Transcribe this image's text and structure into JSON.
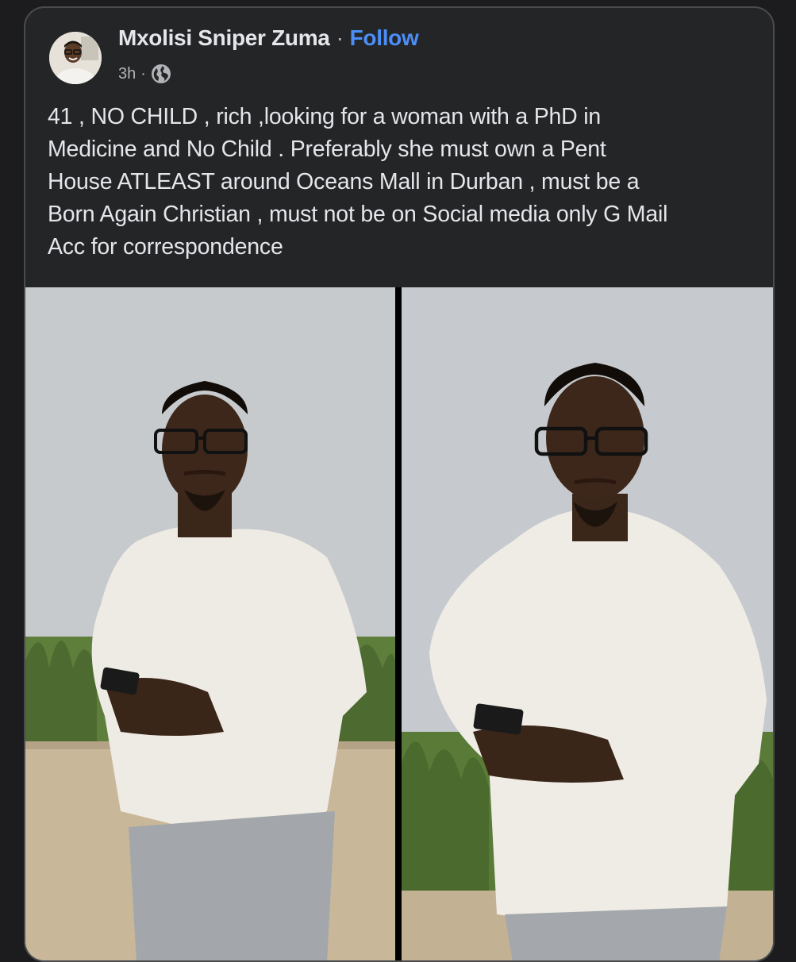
{
  "post": {
    "author_name": "Mxolisi Sniper Zuma",
    "separator": "·",
    "follow_label": "Follow",
    "time": "3h",
    "meta_separator": "·",
    "audience_icon": "globe-icon",
    "text": "41 , NO CHILD , rich ,looking for a woman with a PhD in\nMedicine and No Child . Preferably she must own a Pent\nHouse ATLEAST around Oceans Mall in Durban , must be a\nBorn Again Christian , must not be on Social media only G Mail\nAcc for correspondence",
    "photos": [
      {
        "alt": "man in white shirt holding phone"
      },
      {
        "alt": "man in white shirt holding phone"
      }
    ]
  },
  "colors": {
    "card_bg": "#242526",
    "text": "#e4e6eb",
    "muted": "#b0b3b8",
    "link": "#4c8ef7"
  }
}
